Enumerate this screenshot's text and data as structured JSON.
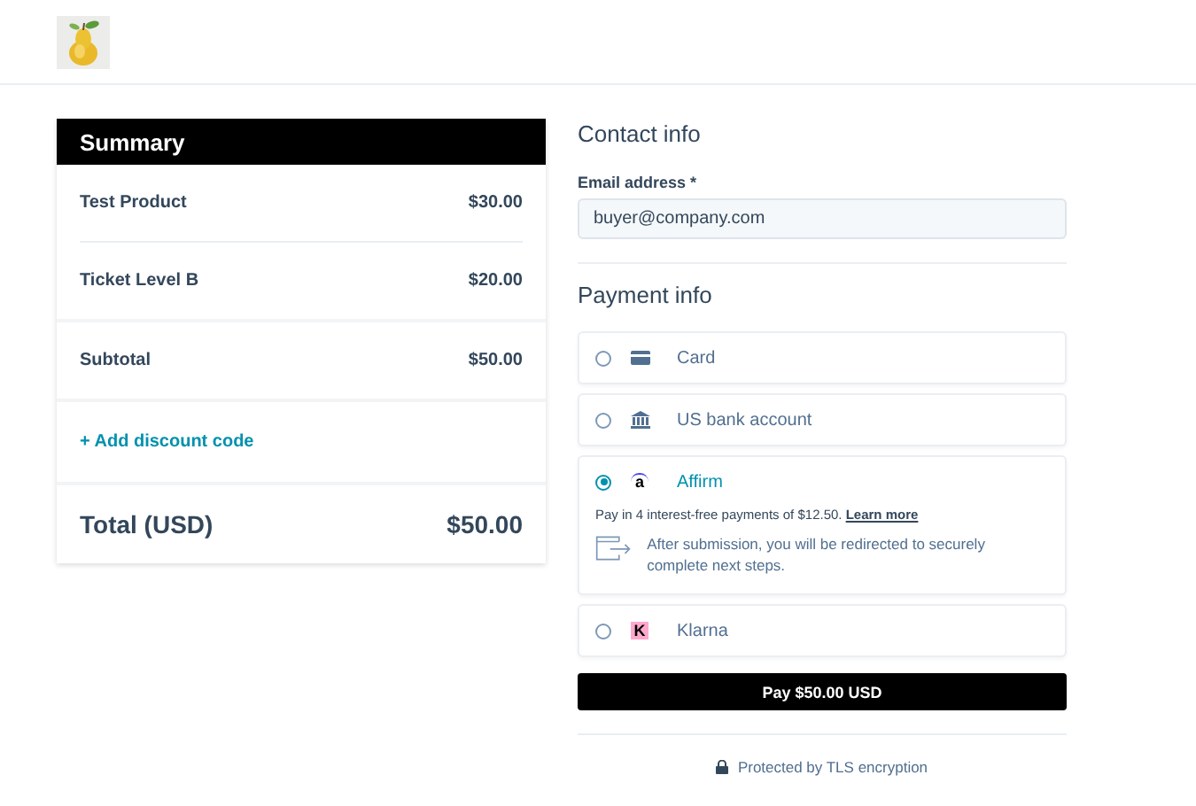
{
  "summary": {
    "title": "Summary",
    "items": [
      {
        "name": "Test Product",
        "price": "$30.00"
      },
      {
        "name": "Ticket Level B",
        "price": "$20.00"
      }
    ],
    "subtotal": {
      "label": "Subtotal",
      "value": "$50.00"
    },
    "discount_link": "+ Add discount code",
    "total": {
      "label": "Total (USD)",
      "value": "$50.00"
    }
  },
  "contact": {
    "title": "Contact info",
    "email_label": "Email address *",
    "email_value": "buyer@company.com"
  },
  "payment": {
    "title": "Payment info",
    "methods": [
      {
        "kind": "card",
        "label": "Card",
        "selected": false
      },
      {
        "kind": "bank",
        "label": "US bank account",
        "selected": false
      },
      {
        "kind": "affirm",
        "label": "Affirm",
        "icon_text": "a",
        "selected": true,
        "details": {
          "text": "Pay in 4 interest-free payments of $12.50.",
          "link": "Learn more",
          "note": "After submission, you will be redirected to securely complete next steps."
        }
      },
      {
        "kind": "klarna",
        "label": "Klarna",
        "icon_text": "K",
        "selected": false
      }
    ]
  },
  "pay_button": "Pay $50.00 USD",
  "footer": {
    "security_text": "Protected by TLS encryption"
  }
}
